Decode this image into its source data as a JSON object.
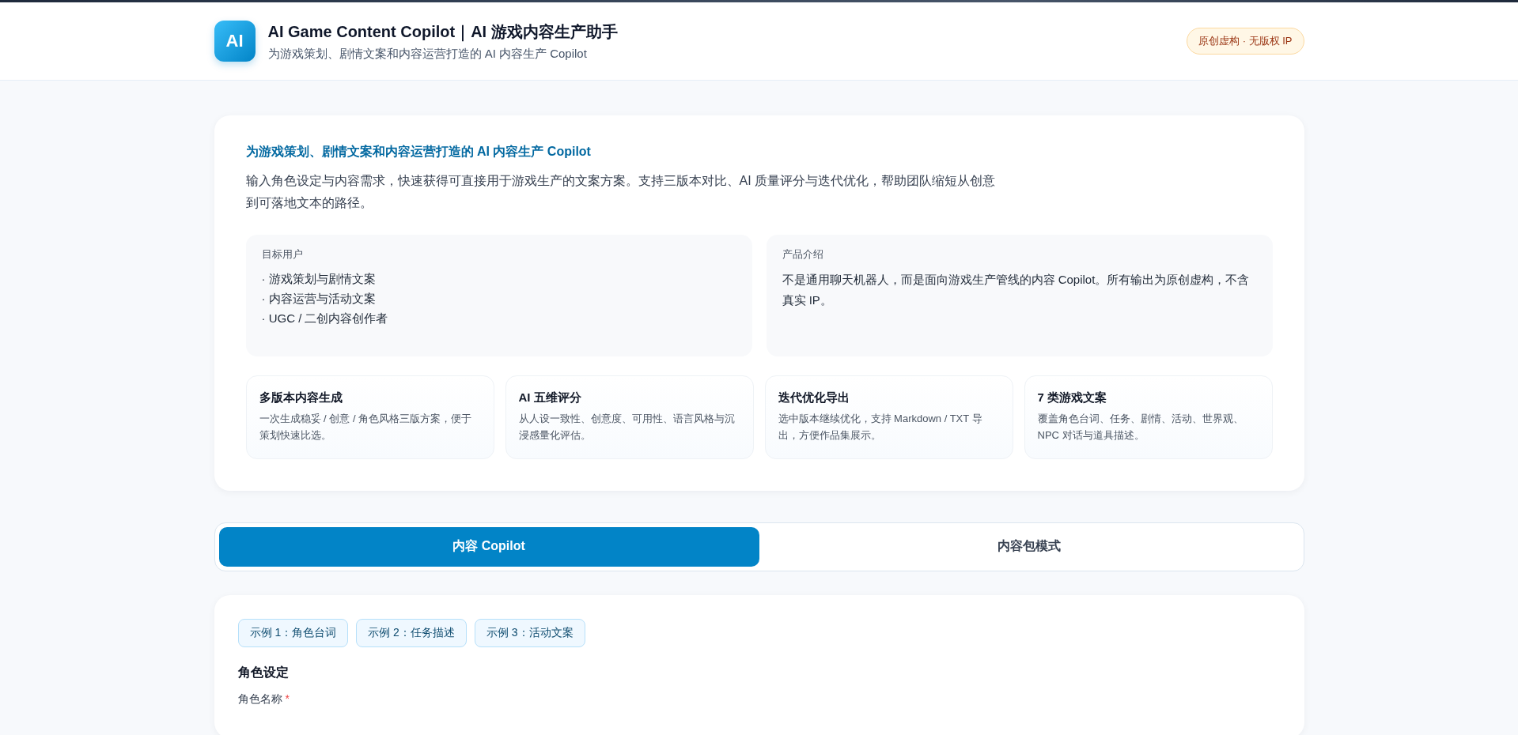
{
  "header": {
    "logo": "AI",
    "title": "AI Game Content Copilot｜AI 游戏内容生产助手",
    "subtitle": "为游戏策划、剧情文案和内容运营打造的 AI 内容生产 Copilot",
    "badge": "原创虚构 · 无版权 IP"
  },
  "intro": {
    "headline": "为游戏策划、剧情文案和内容运营打造的 AI 内容生产 Copilot",
    "description": "输入角色设定与内容需求，快速获得可直接用于游戏生产的文案方案。支持三版本对比、AI 质量评分与迭代优化，帮助团队缩短从创意到可落地文本的路径。",
    "panels": [
      {
        "kind": "list",
        "title": "目标用户",
        "items": [
          "· 游戏策划与剧情文案",
          "· 内容运营与活动文案",
          "· UGC / 二创内容创作者"
        ]
      },
      {
        "kind": "text",
        "title": "产品介绍",
        "text": "不是通用聊天机器人，而是面向游戏生产管线的内容 Copilot。所有输出为原创虚构，不含真实 IP。"
      }
    ],
    "features": [
      {
        "title": "多版本内容生成",
        "text": "一次生成稳妥 / 创意 / 角色风格三版方案，便于策划快速比选。"
      },
      {
        "title": "AI 五维评分",
        "text": "从人设一致性、创意度、可用性、语言风格与沉浸感量化评估。"
      },
      {
        "title": "迭代优化导出",
        "text": "选中版本继续优化，支持 Markdown / TXT 导出，方便作品集展示。"
      },
      {
        "title": "7 类游戏文案",
        "text": "覆盖角色台词、任务、剧情、活动、世界观、NPC 对话与道具描述。"
      }
    ]
  },
  "tabs": [
    {
      "label": "内容 Copilot",
      "selected": true
    },
    {
      "label": "内容包模式",
      "selected": false
    }
  ],
  "form": {
    "examples": [
      "示例 1：角色台词",
      "示例 2：任务描述",
      "示例 3：活动文案"
    ],
    "section_title": "角色设定",
    "field_label": "角色名称",
    "required_mark": "*"
  }
}
